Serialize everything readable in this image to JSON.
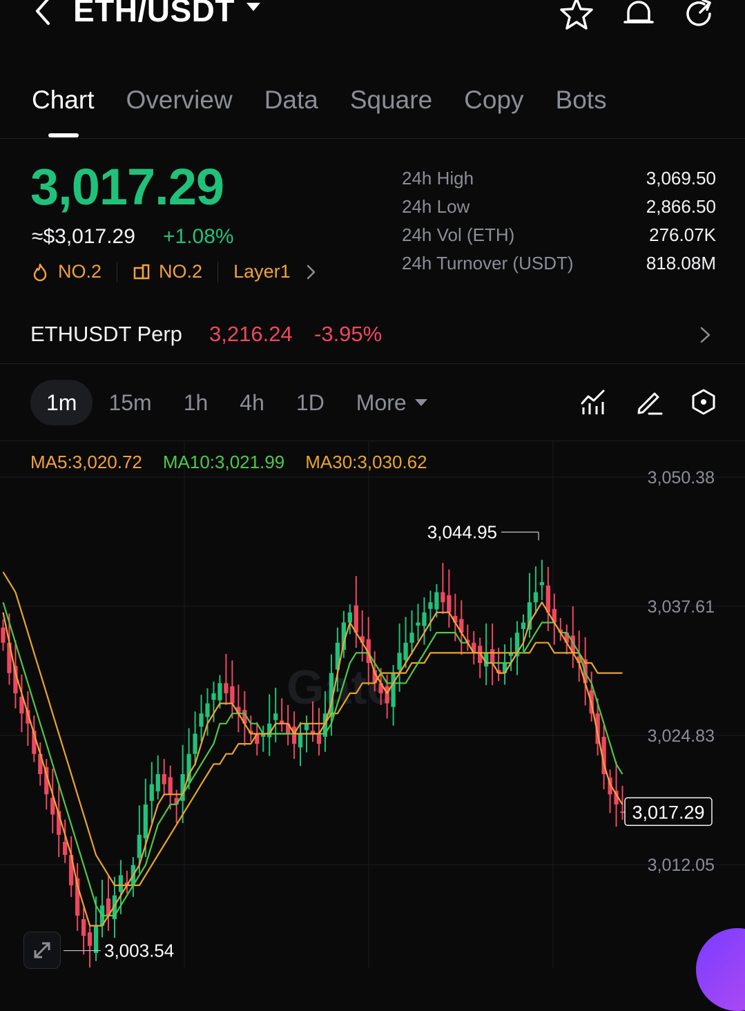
{
  "header": {
    "pair": "ETH/USDT",
    "icons": [
      "back-icon",
      "dropdown-icon",
      "star-icon",
      "bell-icon",
      "share-icon"
    ]
  },
  "tabs": [
    {
      "label": "Chart",
      "active": true
    },
    {
      "label": "Overview"
    },
    {
      "label": "Data"
    },
    {
      "label": "Square"
    },
    {
      "label": "Copy"
    },
    {
      "label": "Bots"
    }
  ],
  "price": {
    "last": "3,017.29",
    "fiat": "≈$3,017.29",
    "change": "+1.08%",
    "tags": [
      {
        "icon": "fire-icon",
        "label": "NO.2"
      },
      {
        "icon": "cube-icon",
        "label": "NO.2"
      },
      {
        "label": "Layer1"
      }
    ]
  },
  "stats": [
    {
      "label": "24h  High",
      "value": "3,069.50"
    },
    {
      "label": "24h  Low",
      "value": "2,866.50"
    },
    {
      "label": "24h  Vol (ETH)",
      "value": "276.07K"
    },
    {
      "label": "24h  Turnover (USDT)",
      "value": "818.08M"
    }
  ],
  "perp": {
    "name": "ETHUSDT Perp",
    "price": "3,216.24",
    "change": "-3.95%"
  },
  "timeframes": [
    "1m",
    "15m",
    "1h",
    "4h",
    "1D"
  ],
  "timeframe_active": "1m",
  "more_label": "More",
  "tools": [
    "indicator-icon",
    "draw-icon",
    "settings-icon"
  ],
  "ma": {
    "ma5": "MA5:3,020.72",
    "ma10": "MA10:3,021.99",
    "ma30": "MA30:3,030.62"
  },
  "colors": {
    "up": "#20c27a",
    "down": "#f0475f",
    "ma5": "#f2a23a",
    "ma10": "#4fc84a",
    "ma30": "#e9a726"
  },
  "watermark": "Gate",
  "chart_data": {
    "type": "candlestick",
    "y_ticks": [
      "3,050.38",
      "3,037.61",
      "3,024.83",
      "3,012.05"
    ],
    "y_tick_values": [
      3050.38,
      3037.61,
      3024.83,
      3012.05
    ],
    "ylim": [
      3002.0,
      3053.0
    ],
    "current_price": "3,017.29",
    "current_value": 3017.29,
    "high_label": "3,044.95",
    "high_value": 3044.95,
    "low_label": "3,003.54",
    "low_value": 3003.54,
    "close": [
      3034,
      3031,
      3029,
      3027,
      3026,
      3023,
      3021,
      3019,
      3017,
      3015,
      3013,
      3010,
      3007,
      3005,
      3004,
      3006,
      3008,
      3007,
      3009,
      3011,
      3010,
      3012,
      3015,
      3018,
      3020,
      3021,
      3020,
      3019,
      3018,
      3021,
      3023,
      3025,
      3027,
      3028,
      3029,
      3030,
      3029,
      3028,
      3027,
      3026,
      3025,
      3024,
      3025,
      3026,
      3027,
      3026,
      3025,
      3024,
      3025,
      3026,
      3025,
      3024,
      3027,
      3031,
      3034,
      3036,
      3037,
      3035,
      3034,
      3032,
      3030,
      3029,
      3028,
      3031,
      3033,
      3034,
      3035,
      3036,
      3037,
      3038,
      3039,
      3038,
      3037,
      3036,
      3035,
      3034,
      3033,
      3032,
      3033,
      3032,
      3031,
      3032,
      3033,
      3035,
      3036,
      3038,
      3039,
      3040,
      3037,
      3036,
      3035,
      3034,
      3033,
      3032,
      3030,
      3027,
      3024,
      3021,
      3019,
      3018,
      3017.29
    ],
    "ma5": [
      3037,
      3034,
      3031,
      3029,
      3027,
      3025,
      3023,
      3021,
      3019,
      3017,
      3015,
      3013,
      3010,
      3008,
      3006,
      3006,
      3006,
      3007,
      3008,
      3009,
      3010,
      3011,
      3012,
      3014,
      3016,
      3018,
      3019,
      3019,
      3019,
      3019,
      3021,
      3022,
      3024,
      3026,
      3027,
      3028,
      3028,
      3028,
      3027,
      3026,
      3025,
      3025,
      3025,
      3025,
      3026,
      3026,
      3026,
      3025,
      3025,
      3025,
      3025,
      3025,
      3026,
      3028,
      3031,
      3034,
      3036,
      3035,
      3034,
      3033,
      3031,
      3030,
      3029,
      3030,
      3031,
      3032,
      3033,
      3034,
      3035,
      3036,
      3037,
      3037,
      3037,
      3036,
      3035,
      3034,
      3033,
      3033,
      3032,
      3032,
      3031,
      3031,
      3032,
      3033,
      3034,
      3036,
      3037,
      3038,
      3037,
      3036,
      3035,
      3034,
      3033,
      3032,
      3030,
      3028,
      3025,
      3022,
      3020,
      3019,
      3018
    ],
    "ma10": [
      3038,
      3036,
      3034,
      3032,
      3030,
      3028,
      3026,
      3024,
      3022,
      3020,
      3018,
      3016,
      3014,
      3012,
      3010,
      3008,
      3007,
      3007,
      3007,
      3008,
      3009,
      3010,
      3011,
      3012,
      3014,
      3016,
      3017,
      3018,
      3018,
      3019,
      3020,
      3021,
      3022,
      3023,
      3024,
      3026,
      3026,
      3027,
      3027,
      3027,
      3026,
      3026,
      3025,
      3025,
      3025,
      3025,
      3025,
      3025,
      3025,
      3025,
      3025,
      3025,
      3025,
      3026,
      3028,
      3030,
      3032,
      3033,
      3033,
      3033,
      3032,
      3031,
      3030,
      3030,
      3030,
      3030,
      3031,
      3032,
      3033,
      3034,
      3035,
      3035,
      3035,
      3035,
      3034,
      3034,
      3033,
      3033,
      3032,
      3032,
      3032,
      3032,
      3032,
      3033,
      3033,
      3034,
      3035,
      3036,
      3036,
      3036,
      3035,
      3035,
      3034,
      3033,
      3031,
      3030,
      3028,
      3026,
      3024,
      3022,
      3021
    ],
    "ma30": [
      3041,
      3040,
      3039,
      3037,
      3035,
      3033,
      3031,
      3029,
      3027,
      3025,
      3023,
      3021,
      3019,
      3017,
      3015,
      3013,
      3012,
      3011,
      3010,
      3010,
      3010,
      3010,
      3010,
      3011,
      3012,
      3013,
      3014,
      3015,
      3016,
      3017,
      3018,
      3019,
      3020,
      3021,
      3022,
      3022,
      3023,
      3023,
      3024,
      3024,
      3024,
      3025,
      3025,
      3025,
      3025,
      3025,
      3025,
      3025,
      3026,
      3026,
      3026,
      3026,
      3026,
      3027,
      3027,
      3028,
      3029,
      3029,
      3030,
      3030,
      3030,
      3031,
      3031,
      3031,
      3031,
      3031,
      3032,
      3032,
      3032,
      3033,
      3033,
      3033,
      3033,
      3033,
      3033,
      3033,
      3033,
      3033,
      3033,
      3033,
      3033,
      3033,
      3033,
      3033,
      3033,
      3033,
      3034,
      3034,
      3034,
      3033,
      3033,
      3033,
      3033,
      3033,
      3032,
      3032,
      3031,
      3031,
      3031,
      3031,
      3031
    ]
  }
}
